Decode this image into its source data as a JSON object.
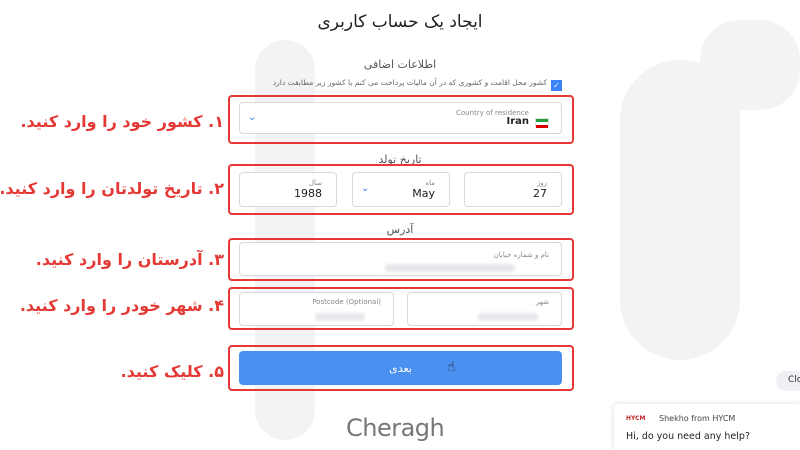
{
  "page_title": "ایجاد یک حساب کاربری",
  "additional_info": {
    "heading": "اطلاعات اضافی",
    "checkbox_text": "کشور محل اقامت و کشوری که در آن مالیات پرداخت می کنم با کشور زیر مطابقت دارد"
  },
  "residence": {
    "label": "Country of residence",
    "value": "Iran",
    "flag": "iran-flag-icon"
  },
  "birth": {
    "heading": "تاریخ تولد",
    "day_label": "روز",
    "day_value": "27",
    "month_label": "ماه",
    "month_value": "May",
    "year_label": "سال",
    "year_value": "1988"
  },
  "address": {
    "heading": "آدرس",
    "street_label": "نام و شماره خیابان",
    "city_label": "شهر",
    "postcode_label": "Postcode (Optional)"
  },
  "annotations": {
    "step1": "۱. کشور خود را وارد کنید.",
    "step2": "۲. تاریخ تولدتان را وارد کنید.",
    "step3": "۳. آدرستان را وارد کنید.",
    "step4": "۴. شهر خودر را وارد کنید.",
    "step5": "۵. کلیک کنید."
  },
  "next_button": "بعدی",
  "logo": "Cheragh",
  "chat": {
    "brand": "HYCM",
    "title": "Shekho from HYCM",
    "message": "Hi, do you need any help?",
    "close": "Clo"
  },
  "colors": {
    "accent": "#4a90f0",
    "annotation": "#e53935"
  }
}
